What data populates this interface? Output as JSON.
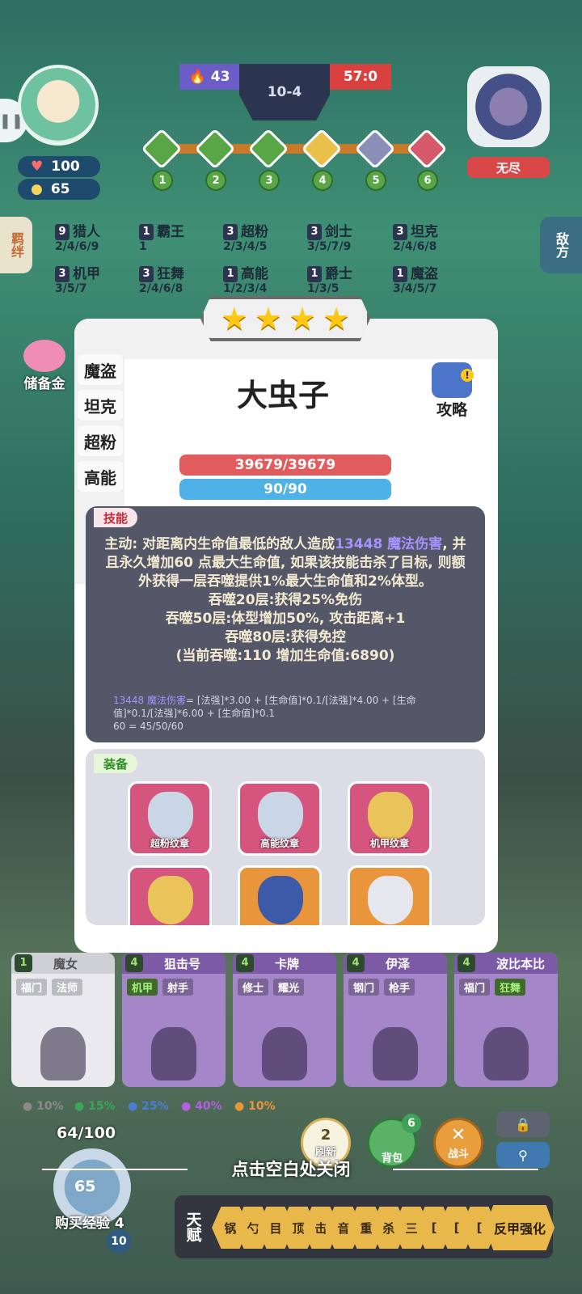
{
  "hud": {
    "hp": "100",
    "coins": "65",
    "fire_count": "43",
    "round": "10-4",
    "score": "57:0",
    "stage_nodes": [
      "1",
      "2",
      "3",
      "4",
      "5",
      "6"
    ],
    "enemy_label": "无尽",
    "synergy_tab": "羁绊",
    "enemy_tab": "敌方",
    "savings_label": "储备金"
  },
  "synergies": [
    {
      "count": "9",
      "name": "猎人",
      "tiers": "2/4/6/9"
    },
    {
      "count": "1",
      "name": "霸王",
      "tiers": "1"
    },
    {
      "count": "3",
      "name": "超粉",
      "tiers": "2/3/4/5"
    },
    {
      "count": "3",
      "name": "剑士",
      "tiers": "3/5/7/9"
    },
    {
      "count": "3",
      "name": "坦克",
      "tiers": "2/4/6/8"
    },
    {
      "count": "3",
      "name": "机甲",
      "tiers": "3/5/7"
    },
    {
      "count": "3",
      "name": "狂舞",
      "tiers": "2/4/6/8"
    },
    {
      "count": "1",
      "name": "高能",
      "tiers": "1/2/3/4"
    },
    {
      "count": "1",
      "name": "爵士",
      "tiers": "1/3/5"
    },
    {
      "count": "1",
      "name": "魔盗",
      "tiers": "3/4/5/7"
    }
  ],
  "detail": {
    "stars": 4,
    "class_tabs": [
      "魔盗",
      "坦克",
      "超粉",
      "高能"
    ],
    "name": "大虫子",
    "strategy_label": "攻略",
    "hp_text": "39679/39679",
    "mp_text": "90/90",
    "skill_tag": "技能",
    "skill_lines": [
      "主动: 对距离内生命值最低的敌人造成",
      "13448 魔法伤害",
      ", 并且永久增加60 点最大生命值, 如果该技能击杀了目标, 则额外获得一层吞噬提供1%最大生命值和2%体型。",
      "吞噬20层:获得25%免伤",
      "吞噬50层:体型增加50%, 攻击距离+1",
      "吞噬80层:获得免控",
      "(当前吞噬:110 增加生命值:6890)"
    ],
    "formula_hl": "13448 魔法伤害",
    "formula_rest": "= [法强]*3.00 + [生命值]*0.1/[法强]*4.00 + [生命值]*0.1/[法强]*6.00 + [生命值]*0.1",
    "formula_line2": "60 = 45/50/60",
    "equip_tag": "装备",
    "equipment": [
      {
        "name": "超粉纹章",
        "color": "#d6557f"
      },
      {
        "name": "高能纹章",
        "color": "#d6557f"
      },
      {
        "name": "机甲纹章",
        "color": "#d6557f"
      },
      {
        "name": "",
        "color": "#d6557f"
      },
      {
        "name": "",
        "color": "#e8953b"
      },
      {
        "name": "",
        "color": "#e8953b"
      }
    ]
  },
  "shop": {
    "cards": [
      {
        "cost": "1",
        "name": "魔女",
        "traits": [
          "福门",
          "法师"
        ],
        "active": [
          false,
          false
        ],
        "color": "#e9e9ee"
      },
      {
        "cost": "4",
        "name": "狙击号",
        "traits": [
          "机甲",
          "射手"
        ],
        "active": [
          true,
          false
        ],
        "color": "#a587c9"
      },
      {
        "cost": "4",
        "name": "卡牌",
        "traits": [
          "修士",
          "耀光"
        ],
        "active": [
          false,
          false
        ],
        "color": "#a587c9"
      },
      {
        "cost": "4",
        "name": "伊泽",
        "traits": [
          "钢门",
          "枪手"
        ],
        "active": [
          false,
          false
        ],
        "color": "#a587c9"
      },
      {
        "cost": "4",
        "name": "波比本比",
        "traits": [
          "福门",
          "狂舞"
        ],
        "active": [
          false,
          true
        ],
        "color": "#a587c9"
      }
    ],
    "odds": [
      "10%",
      "15%",
      "25%",
      "40%",
      "10%"
    ],
    "odds_colors": [
      "#8a8a8a",
      "#3aa85a",
      "#4a7fd8",
      "#b25fe0",
      "#e8953b"
    ],
    "exp_text": "64/100",
    "exp_coins": "65",
    "buy_exp": "购买经验",
    "buy_cost": "4",
    "level": "10",
    "refresh_cost": "2",
    "refresh_label": "刷新",
    "bag_count": "6",
    "bag_label": "背包",
    "battle_label": "战斗"
  },
  "close_tip": "点击空白处关闭",
  "talent": {
    "label": "天赋",
    "items": [
      "锅",
      "勺",
      "目",
      "顶",
      "击",
      "音",
      "重",
      "杀",
      "三",
      "[",
      "[",
      "["
    ],
    "last": "反甲强化"
  }
}
